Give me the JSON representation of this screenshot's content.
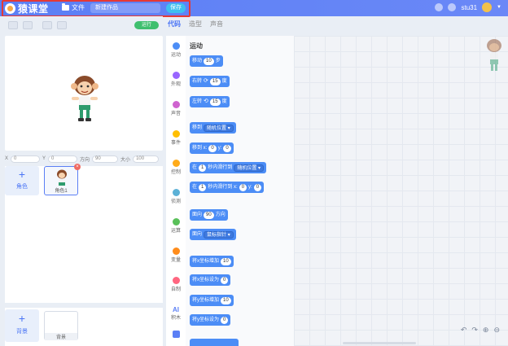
{
  "header": {
    "logo_text": "猿课堂",
    "file_menu": "文件",
    "project_title": "新建作品",
    "save_label": "保存",
    "username": "stu31"
  },
  "stage": {
    "run_label": "运行",
    "props": {
      "x_label": "X",
      "x_value": "0",
      "y_label": "Y",
      "y_value": "0",
      "direction_label": "方向",
      "direction_value": "90",
      "size_label": "大小",
      "size_value": "100"
    }
  },
  "sprites": {
    "add_label": "角色",
    "items": [
      {
        "label": "角色1"
      }
    ]
  },
  "backdrops": {
    "add_label": "背景",
    "items": [
      {
        "label": "背景"
      }
    ]
  },
  "tabs": [
    {
      "label": "代码",
      "active": true
    },
    {
      "label": "造型",
      "active": false
    },
    {
      "label": "声音",
      "active": false
    }
  ],
  "categories": [
    {
      "label": "运动",
      "color": "#4c8df6"
    },
    {
      "label": "外观",
      "color": "#9966ff"
    },
    {
      "label": "声音",
      "color": "#cf63cf"
    },
    {
      "label": "事件",
      "color": "#ffbf00"
    },
    {
      "label": "控制",
      "color": "#ffab19"
    },
    {
      "label": "侦测",
      "color": "#5cb1d6"
    },
    {
      "label": "运算",
      "color": "#59c059"
    },
    {
      "label": "变量",
      "color": "#ff8c1a"
    },
    {
      "label": "自制",
      "color": "#ff6680"
    },
    {
      "label": "AI",
      "sublabel": "积木",
      "color": "#5b7ff5"
    }
  ],
  "palette": {
    "title": "运动",
    "blocks": {
      "move": {
        "pre": "移动",
        "value": "10",
        "post": "步"
      },
      "turn_right": {
        "pre": "右转",
        "value": "15",
        "post": "度"
      },
      "turn_left": {
        "pre": "左转",
        "value": "15",
        "post": "度"
      },
      "goto": {
        "pre": "移到",
        "dropdown": "随机位置"
      },
      "goto_xy": {
        "pre": "移到 x:",
        "x": "0",
        "mid": "y:",
        "y": "0"
      },
      "glide": {
        "pre": "在",
        "secs": "1",
        "mid": "秒内滑行到",
        "dropdown": "随机位置"
      },
      "glide_xy": {
        "pre": "在",
        "secs": "1",
        "mid": "秒内滑行到 x:",
        "x": "0",
        "ylabel": "y:",
        "y": "0"
      },
      "point": {
        "pre": "面向",
        "value": "90",
        "post": "方向"
      },
      "point_towards": {
        "pre": "面向",
        "dropdown": "鼠标指针"
      },
      "change_x": {
        "pre": "将x坐标增加",
        "value": "10"
      },
      "set_x": {
        "pre": "将x坐标设为",
        "value": "0"
      },
      "change_y": {
        "pre": "将y坐标增加",
        "value": "10"
      },
      "set_y": {
        "pre": "将y坐标设为",
        "value": "0"
      }
    }
  },
  "colors": {
    "accent": "#5b7ff5",
    "motion": "#4c8df6",
    "run": "#3fbf6f",
    "highlight": "#e53935"
  }
}
